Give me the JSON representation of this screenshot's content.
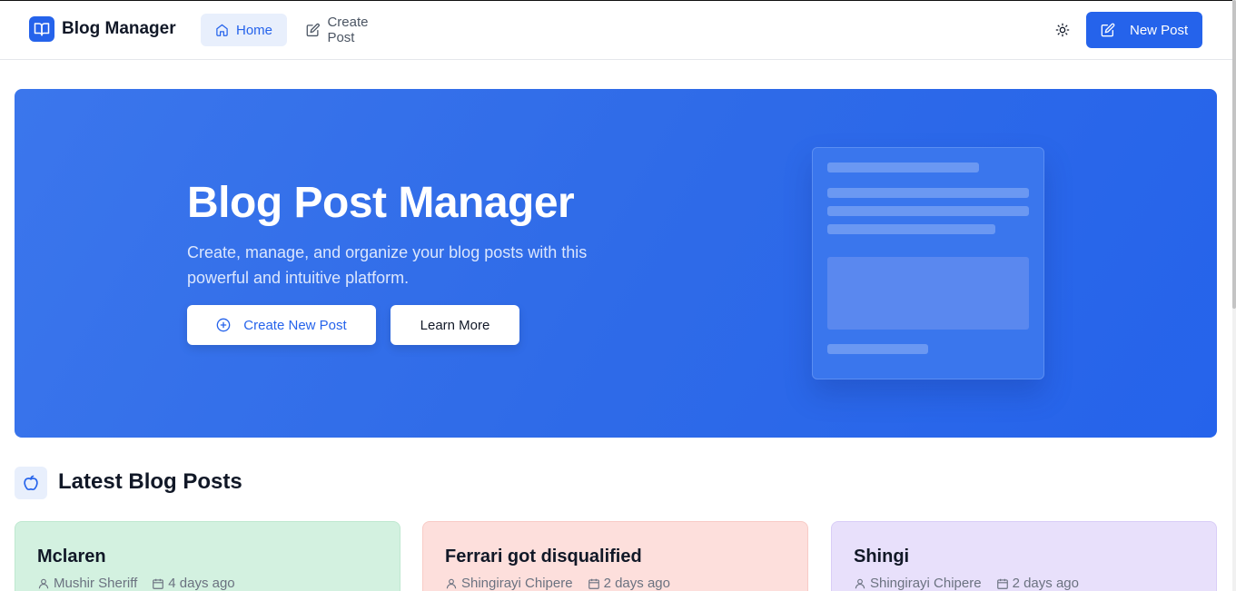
{
  "header": {
    "brand_name": "Blog Manager",
    "nav": [
      {
        "label": "Home",
        "active": true
      },
      {
        "label": "Create Post",
        "active": false
      }
    ],
    "new_post_label": "New Post"
  },
  "hero": {
    "title": "Blog Post Manager",
    "subtitle": "Create, manage, and organize your blog posts with this powerful and intuitive platform.",
    "create_button": "Create New Post",
    "learn_button": "Learn More"
  },
  "latest": {
    "title": "Latest Blog Posts",
    "posts": [
      {
        "title": "Mclaren",
        "author": "Mushir Sheriff",
        "date": "4 days ago"
      },
      {
        "title": "Ferrari got disqualified",
        "author": "Shingirayi Chipere",
        "date": "2 days ago"
      },
      {
        "title": "Shingi",
        "author": "Shingirayi Chipere",
        "date": "2 days ago"
      }
    ]
  },
  "colors": {
    "primary": "#2563eb",
    "card_green": "#d3f1e0",
    "card_red": "#fddfdc",
    "card_purple": "#e8e0fb"
  },
  "icons": [
    "book-icon",
    "home-icon",
    "edit-icon",
    "sun-icon",
    "plus-circle-icon",
    "apple-icon",
    "user-icon",
    "calendar-icon"
  ]
}
